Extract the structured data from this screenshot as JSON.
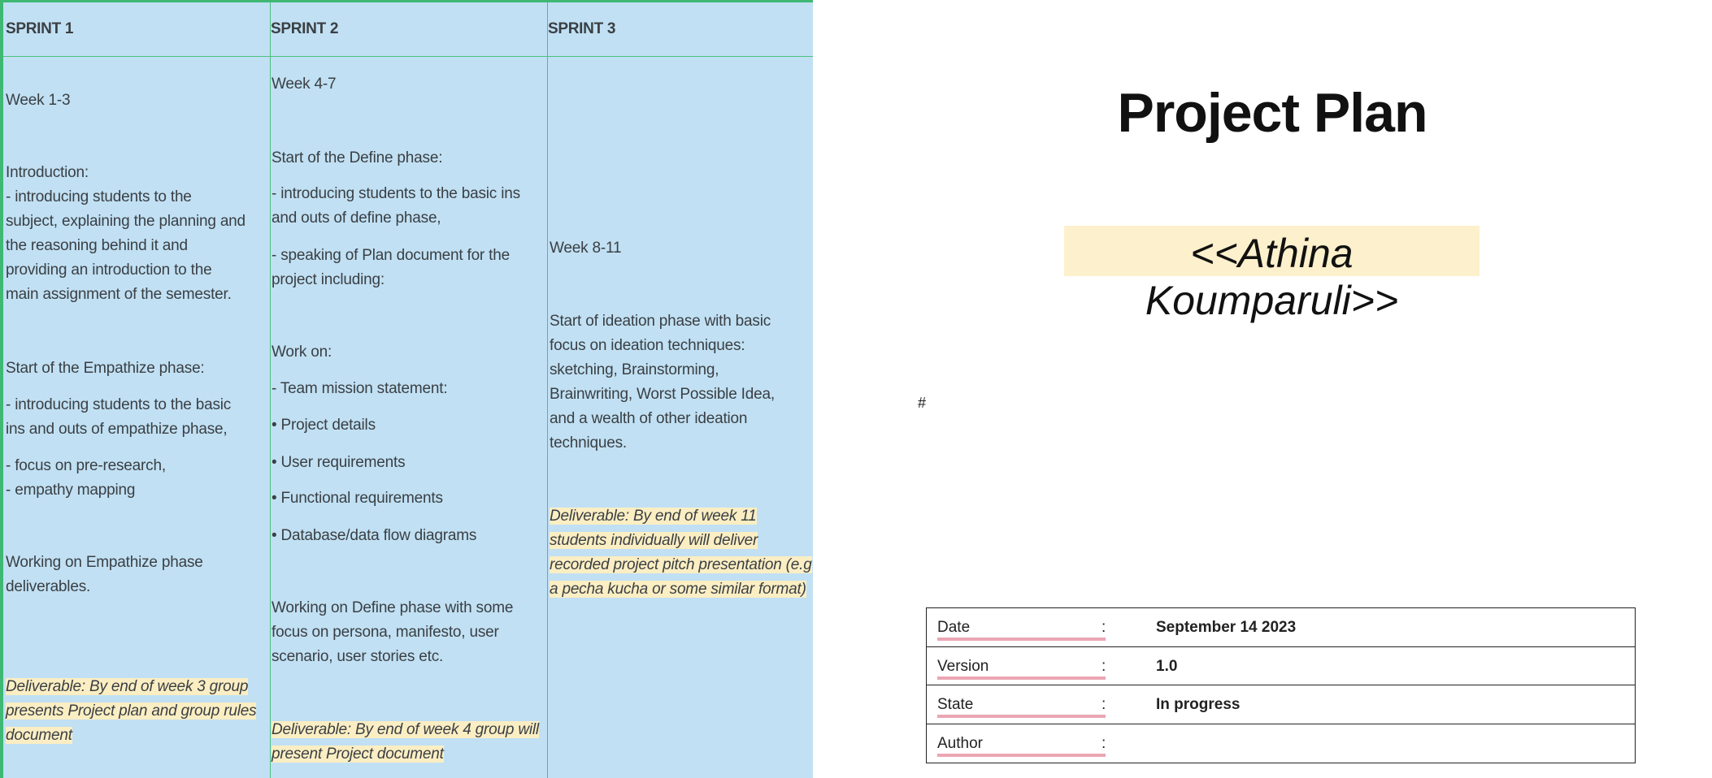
{
  "sprints": [
    {
      "header": "SPRINT 1",
      "blocks": [
        {
          "text": "Week 1-3"
        },
        {
          "text": "Introduction:\n- introducing students to the\nsubject, explaining the planning and\nthe reasoning behind it and\nproviding an introduction to the\nmain assignment of the semester."
        },
        {
          "text": "Start of the Empathize phase:"
        },
        {
          "text": "- introducing students to the basic\nins and outs of empathize phase,"
        },
        {
          "text": "- focus on pre-research,\n- empathy mapping"
        },
        {
          "text": "Working on Empathize phase\ndeliverables."
        },
        {
          "text": "Deliverable: By end of week 3 group\npresents Project plan and group rules\ndocument"
        }
      ]
    },
    {
      "header": "SPRINT 2",
      "blocks": [
        {
          "text": "Week 4-7"
        },
        {
          "text": "Start of the Define phase:"
        },
        {
          "text": "- introducing students to the basic  ins\nand outs of define phase,"
        },
        {
          "text": "- speaking of Plan document for the\nproject including:"
        },
        {
          "text": "Work on:"
        },
        {
          "text": "- Team mission statement:"
        },
        {
          "text": "• Project details"
        },
        {
          "text": "• User requirements"
        },
        {
          "text": "• Functional requirements"
        },
        {
          "text": "• Database/data flow diagrams"
        },
        {
          "text": "Working on Define phase with some\nfocus on persona, manifesto, user\nscenario, user stories etc."
        },
        {
          "text": "Deliverable: By end of week 4 group will\npresent Project document"
        }
      ]
    },
    {
      "header": "SPRINT 3",
      "blocks": [
        {
          "text": "Week 8-11"
        },
        {
          "text": "Start of ideation phase with basic\nfocus on ideation techniques:\nsketching, Brainstorming,\nBrainwriting, Worst Possible Idea,\nand a wealth of other ideation\ntechniques."
        },
        {
          "text": "Deliverable: By end of week 11\nstudents individually will deliver\nrecorded project pitch presentation (e.g\na pecha kucha or some similar format)"
        }
      ]
    }
  ],
  "cover": {
    "title": "Project Plan",
    "author_placeholder": "<<Athina Koumparuli>>",
    "hash": "#",
    "meta": [
      {
        "label": "Date",
        "colon": ":",
        "value": "September 14 2023"
      },
      {
        "label": "Version",
        "colon": ":",
        "value": "1.0"
      },
      {
        "label": "State",
        "colon": ":",
        "value": "In progress"
      },
      {
        "label": "Author",
        "colon": ":",
        "value": ""
      }
    ]
  },
  "colors": {
    "table_bg": "#c1e0f3",
    "border": "#3fb874",
    "highlight": "#fbeec3",
    "underline": "#eba6b4"
  }
}
